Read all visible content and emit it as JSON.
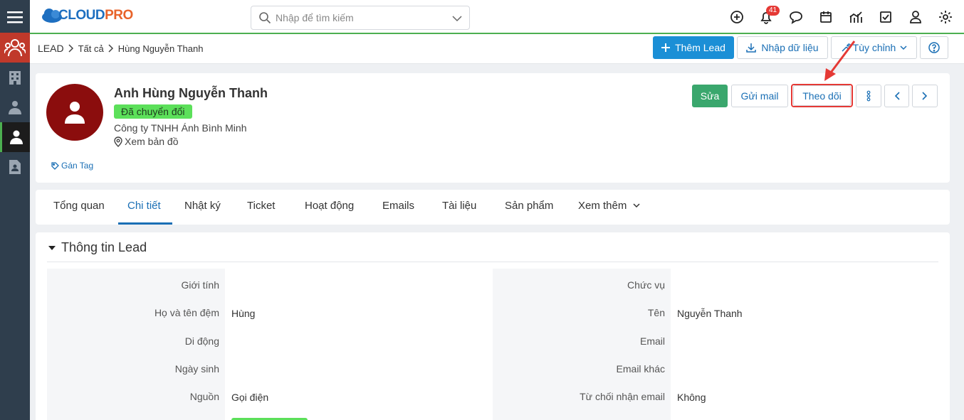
{
  "sidebar": {
    "items": [
      "menu-icon",
      "leads-group-icon",
      "building-icon",
      "contacts-icon",
      "person-icon",
      "document-icon"
    ]
  },
  "topbar": {
    "logo": {
      "cloud": "CLOUD",
      "pro": "PRO"
    },
    "search_placeholder": "Nhập để tìm kiếm",
    "notification_count": "41",
    "icons": [
      "add-icon",
      "bell-icon",
      "chat-icon",
      "calendar-icon",
      "chart-icon",
      "task-icon",
      "user-icon",
      "settings-icon"
    ]
  },
  "breadcrumb": {
    "module": "LEAD",
    "filter": "Tất cả",
    "record": "Hùng Nguyễn Thanh"
  },
  "actions": {
    "add_lead": "Thêm Lead",
    "import": "Nhập dữ liệu",
    "customize": "Tùy chỉnh"
  },
  "lead": {
    "name": "Anh Hùng Nguyễn Thanh",
    "status": "Đã chuyển đổi",
    "company": "Công ty TNHH Ánh Bình Minh",
    "map_link": "Xem bản đồ",
    "tag_link": "Gán Tag"
  },
  "record_actions": {
    "edit": "Sửa",
    "send_mail": "Gửi mail",
    "follow": "Theo dõi"
  },
  "tabs": [
    "Tổng quan",
    "Chi tiết",
    "Nhật ký",
    "Ticket",
    "Hoạt động",
    "Emails",
    "Tài liệu",
    "Sản phẩm",
    "Xem thêm"
  ],
  "section": {
    "title": "Thông tin Lead",
    "left": [
      {
        "label": "Giới tính",
        "value": ""
      },
      {
        "label": "Họ và tên đệm",
        "value": "Hùng"
      },
      {
        "label": "Di động",
        "value": ""
      },
      {
        "label": "Ngày sinh",
        "value": ""
      },
      {
        "label": "Nguồn",
        "value": "Gọi điện"
      }
    ],
    "right": [
      {
        "label": "Chức vụ",
        "value": ""
      },
      {
        "label": "Tên",
        "value": "Nguyễn Thanh"
      },
      {
        "label": "Email",
        "value": ""
      },
      {
        "label": "Email khác",
        "value": ""
      },
      {
        "label": "Từ chối nhận email",
        "value": "Không"
      }
    ]
  },
  "colors": {
    "accent": "#1b8fd6",
    "success": "#3aa76d",
    "status_badge": "#5ce05a",
    "sidebar": "#2f3e4d",
    "highlight": "#e53935"
  }
}
